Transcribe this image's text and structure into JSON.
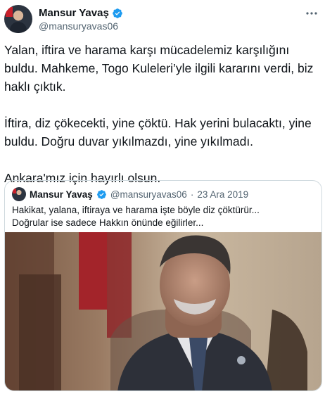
{
  "author": {
    "display_name": "Mansur Yavaş",
    "handle": "@mansuryavas06",
    "verified_icon": "verified-badge-icon",
    "avatar_icon": "avatar-photo"
  },
  "tweet": {
    "text": "Yalan, iftira ve harama karşı mücadelemiz karşılığını buldu. Mahkeme, Togo Kuleleri’yle ilgili kararını verdi, biz haklı çıktık.\n\nİftira, diz çökecekti, yine çöktü. Hak yerini bulacaktı, yine buldu. Doğru duvar yıkılmazdı, yine yıkılmadı.\n\nAnkara'mız için hayırlı olsun."
  },
  "quoted": {
    "display_name": "Mansur Yavaş",
    "handle": "@mansuryavas06",
    "separator": "·",
    "date": "23 Ara 2019",
    "text": "Hakikat, yalana, iftiraya ve harama işte böyle diz çöktürür...\nDoğrular ise sadece Hakkın önünde eğilirler...",
    "media": "video-frame-man-in-suit"
  },
  "colors": {
    "text": "#0f1419",
    "secondary": "#536471",
    "verified": "#1d9bf0",
    "border": "#cfd9de"
  }
}
